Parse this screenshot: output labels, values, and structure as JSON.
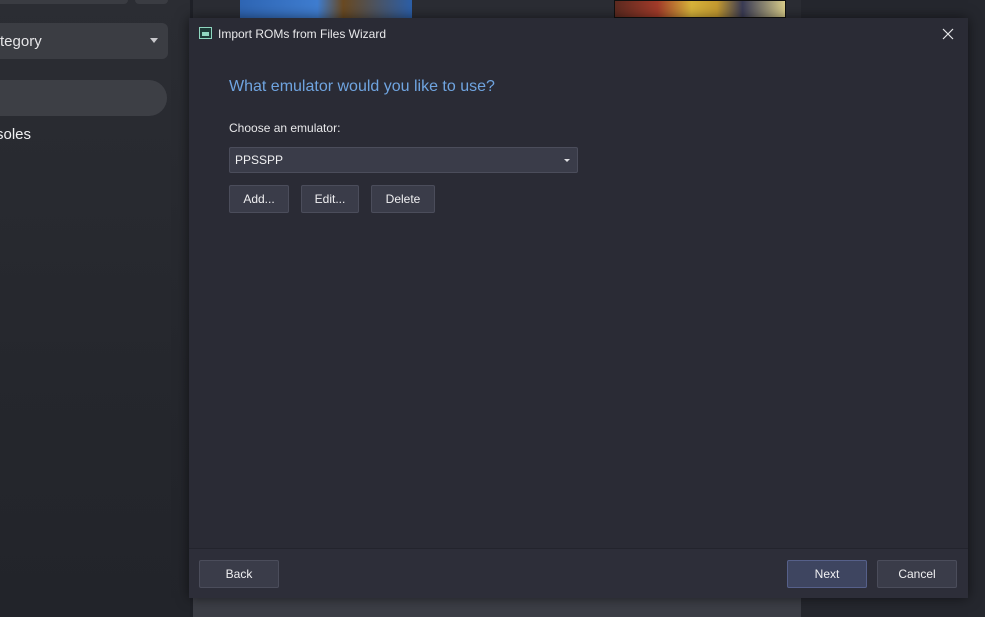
{
  "background_app": {
    "category_dropdown_label": "tegory",
    "sidebar_item_label": "soles"
  },
  "dialog": {
    "title": "Import ROMs from Files Wizard",
    "heading": "What emulator would you like to use?",
    "choose_label": "Choose an emulator:",
    "emulator_select": {
      "selected": "PPSSPP"
    },
    "buttons": {
      "add": "Add...",
      "edit": "Edit...",
      "delete": "Delete"
    },
    "footer": {
      "back": "Back",
      "next": "Next",
      "cancel": "Cancel"
    }
  },
  "colors": {
    "heading": "#6fa4e0",
    "dialog_bg": "#2a2b35",
    "primary_button": "#3e4560"
  },
  "icons": {
    "app": "rom-wizard-icon",
    "close": "close-icon",
    "dropdown": "chevron-down-icon"
  }
}
